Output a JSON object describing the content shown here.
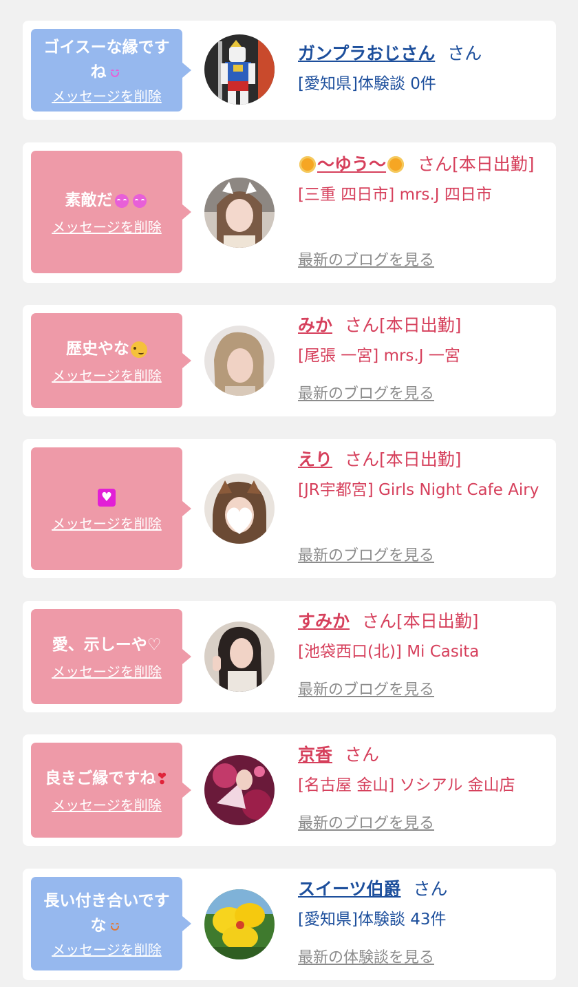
{
  "delete_label": "メッセージを削除",
  "colors": {
    "card_bg": "#ffffff",
    "page_bg": "#f1f1f1",
    "bubble_blue": "#96b8ee",
    "bubble_pink": "#ee9aa8",
    "name_blue": "#1d4f9c",
    "name_pink": "#d6405c",
    "link_gray": "#8c8c8c"
  },
  "cards": [
    {
      "bubble_color": "blue",
      "message_text": "ゴイスーな縁です\nね",
      "message_emoji": "laughing-face-emoji",
      "avatar": "gundam-robot-photo",
      "name": "ガンプラおじさん",
      "name_suffix": "さん",
      "detail": "[愛知県]体験談 0件",
      "link": ""
    },
    {
      "bubble_color": "pink",
      "message_text": "素敵だ",
      "message_emoji": "smiling-devil-emoji",
      "avatar": "woman-cat-ears-photo",
      "name": "〜ゆう〜",
      "name_decoration": "sunflower-icon",
      "name_suffix": "さん[本日出勤]",
      "detail": "[三重 四日市] mrs.J 四日市",
      "link": "最新のブログを見る"
    },
    {
      "bubble_color": "pink",
      "message_text": "歴史やな",
      "message_emoji": "woozy-face-emoji",
      "avatar": "woman-blonde-hair-photo",
      "name": "みか",
      "name_suffix": "さん[本日出勤]",
      "detail": "[尾張 一宮] mrs.J 一宮",
      "link": "最新のブログを見る"
    },
    {
      "bubble_color": "pink",
      "message_text": "",
      "message_emoji": "heart-box-emoji",
      "avatar": "woman-dog-ears-photo",
      "name": "えり",
      "name_suffix": "さん[本日出勤]",
      "detail": "[JR宇都宮] Girls Night Cafe Airy",
      "link": "最新のブログを見る"
    },
    {
      "bubble_color": "pink",
      "message_text": "愛、示しーや♡",
      "message_emoji": "",
      "avatar": "woman-long-hair-photo",
      "name": "すみか",
      "name_suffix": "さん[本日出勤]",
      "detail": "[池袋西口(北)] Mi Casita",
      "link": "最新のブログを見る"
    },
    {
      "bubble_color": "pink",
      "message_text": "良きご縁ですね",
      "message_emoji": "two-hearts-emoji",
      "avatar": "kimono-fan-photo",
      "name": "京香",
      "name_suffix": "さん",
      "detail": "[名古屋 金山] ソシアル 金山店",
      "link": "最新のブログを見る"
    },
    {
      "bubble_color": "blue",
      "message_text": "長い付き合いです\nな",
      "message_emoji": "laughing-face-emoji",
      "avatar": "yellow-flower-photo",
      "name": "スイーツ伯爵",
      "name_suffix": "さん",
      "detail": "[愛知県]体験談 43件",
      "link": "最新の体験談を見る"
    }
  ]
}
